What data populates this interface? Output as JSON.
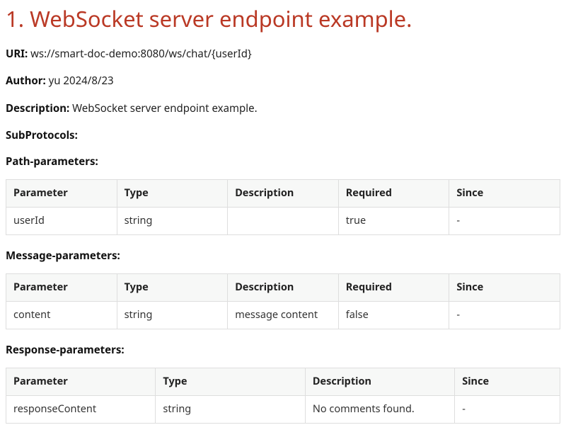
{
  "heading": "1. WebSocket server endpoint example.",
  "fields": {
    "uri_label": "URI:",
    "uri_value": "ws://smart-doc-demo:8080/ws/chat/{userId}",
    "author_label": "Author:",
    "author_value": "yu 2024/8/23",
    "description_label": "Description:",
    "description_value": "WebSocket server endpoint example.",
    "subprotocols_label": "SubProtocols:"
  },
  "sections": {
    "path": {
      "label": "Path-parameters:",
      "headers": [
        "Parameter",
        "Type",
        "Description",
        "Required",
        "Since"
      ],
      "rows": [
        {
          "parameter": "userId",
          "type": "string",
          "description": "",
          "required": "true",
          "since": "-"
        }
      ]
    },
    "message": {
      "label": "Message-parameters:",
      "headers": [
        "Parameter",
        "Type",
        "Description",
        "Required",
        "Since"
      ],
      "rows": [
        {
          "parameter": "content",
          "type": "string",
          "description": "message content",
          "required": "false",
          "since": "-"
        }
      ]
    },
    "response": {
      "label": "Response-parameters:",
      "headers": [
        "Parameter",
        "Type",
        "Description",
        "Since"
      ],
      "rows": [
        {
          "parameter": "responseContent",
          "type": "string",
          "description": "No comments found.",
          "since": "-"
        }
      ]
    }
  }
}
